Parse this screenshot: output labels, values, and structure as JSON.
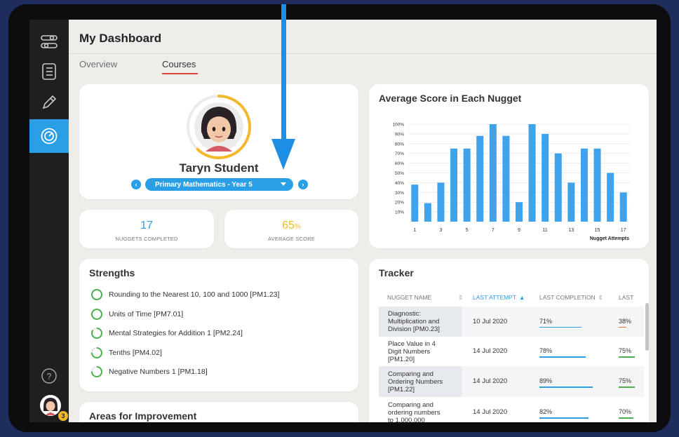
{
  "header": {
    "title": "My Dashboard"
  },
  "tabs": [
    {
      "label": "Overview",
      "active": false
    },
    {
      "label": "Courses",
      "active": true
    }
  ],
  "profile": {
    "student_name": "Taryn Student",
    "course": "Primary Mathematics - Year 5",
    "progress_ring_fraction": 0.62
  },
  "stats": {
    "nuggets_completed": {
      "value": "17",
      "label": "NUGGETS COMPLETED"
    },
    "average_score": {
      "value": "65",
      "unit": "%",
      "label": "AVERAGE SCORE"
    }
  },
  "chart_data": {
    "type": "bar",
    "title": "Average Score in Each Nugget",
    "xlabel": "Nugget Attempts",
    "ylabel": "",
    "x": [
      1,
      2,
      3,
      4,
      5,
      6,
      7,
      8,
      9,
      10,
      11,
      12,
      13,
      14,
      15,
      16,
      17
    ],
    "values": [
      38,
      19,
      40,
      75,
      75,
      88,
      100,
      88,
      20,
      100,
      90,
      70,
      40,
      75,
      75,
      50,
      30
    ],
    "y_ticks": [
      "10%",
      "20%",
      "30%",
      "40%",
      "50%",
      "60%",
      "70%",
      "80%",
      "90%",
      "100%"
    ],
    "x_ticks": [
      "1",
      "3",
      "5",
      "7",
      "9",
      "11",
      "13",
      "15",
      "17"
    ],
    "ylim": [
      0,
      100
    ],
    "color": "#3fa3ec",
    "grid": true
  },
  "strengths": {
    "title": "Strengths",
    "items": [
      {
        "label": "Rounding to the Nearest 10, 100 and 1000 [PM1.23]",
        "progress": 1.0
      },
      {
        "label": "Units of Time [PM7.01]",
        "progress": 1.0
      },
      {
        "label": "Mental Strategies for Addition 1 [PM2.24]",
        "progress": 0.85
      },
      {
        "label": "Tenths [PM4.02]",
        "progress": 0.75
      },
      {
        "label": "Negative Numbers 1 [PM1.18]",
        "progress": 0.75
      }
    ]
  },
  "improvement": {
    "title": "Areas for Improvement"
  },
  "tracker": {
    "title": "Tracker",
    "columns": [
      "NUGGET NAME",
      "LAST ATTEMPT",
      "LAST COMPLETION",
      "LAST"
    ],
    "rows": [
      {
        "name": [
          "Diagnostic:",
          "Multiplication and",
          "Division [PM0.23]"
        ],
        "last_attempt": "10 Jul 2020",
        "last_completion": "71%",
        "completion_value": 0.71,
        "last": "38%",
        "last_value": 0.38,
        "last_color": "#e8743b"
      },
      {
        "name": [
          "Place Value in 4",
          "Digit Numbers",
          "[PM1.20]"
        ],
        "last_attempt": "14 Jul 2020",
        "last_completion": "78%",
        "completion_value": 0.78,
        "last": "75%",
        "last_value": 0.75,
        "last_color": "#4cb050"
      },
      {
        "name": [
          "Comparing and",
          "Ordering Numbers",
          "[PM1.22]"
        ],
        "last_attempt": "14 Jul 2020",
        "last_completion": "89%",
        "completion_value": 0.89,
        "last": "75%",
        "last_value": 0.75,
        "last_color": "#4cb050"
      },
      {
        "name": [
          "Comparing and",
          "ordering numbers",
          "to 1,000,000"
        ],
        "last_attempt": "14 Jul 2020",
        "last_completion": "82%",
        "completion_value": 0.82,
        "last": "70%",
        "last_value": 0.7,
        "last_color": "#4cb050"
      }
    ]
  },
  "sidebar": {
    "items": [
      "settings-icon",
      "list-icon",
      "pencil-icon",
      "dashboard-icon"
    ],
    "active": "dashboard-icon",
    "help": "?",
    "notification_count": "3"
  },
  "colors": {
    "accent": "#2a9fe6",
    "tab_underline": "#e1443a",
    "gold": "#f2b92d",
    "green": "#4cb050"
  }
}
